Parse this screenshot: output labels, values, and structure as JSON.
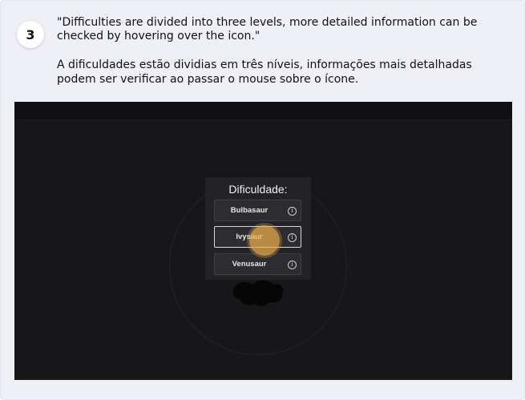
{
  "step": {
    "number": "3"
  },
  "instruction": {
    "english": "\"Difficulties are divided into three levels, more detailed information can be checked by hovering over the icon.\"",
    "portuguese": "A dificuldades estão dividias em três níveis, informações mais detalhadas podem ser verificar ao passar o mouse sobre o ícone."
  },
  "screenshot": {
    "panel_title": "Dificuldade:",
    "options": [
      {
        "label": "Bulbasaur",
        "info_icon": "info-circle-icon",
        "selected": false
      },
      {
        "label": "Ivysaur",
        "info_icon": "info-circle-icon",
        "selected": true
      },
      {
        "label": "Venusaur",
        "info_icon": "info-circle-icon",
        "selected": false
      }
    ],
    "info_glyph": "i"
  },
  "colors": {
    "card_background": "#eeeff7",
    "screenshot_background": "#17171a",
    "click_marker": "#efb04c"
  }
}
